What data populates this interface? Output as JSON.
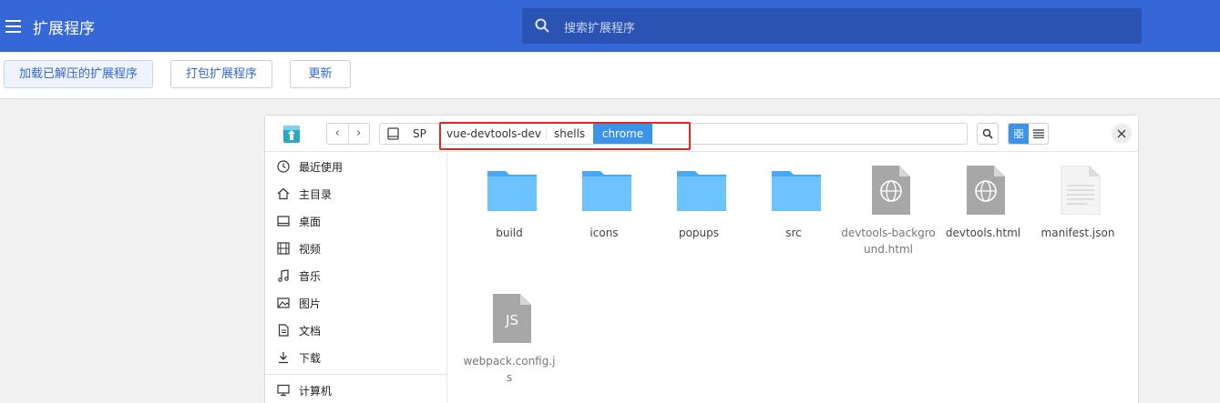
{
  "appbar": {
    "title": "扩展程序",
    "search_placeholder": "搜索扩展程序",
    "color": "#3567d7"
  },
  "toolbar": {
    "load_unpacked": "加载已解压的扩展程序",
    "pack": "打包扩展程序",
    "update": "更新"
  },
  "dialog": {
    "breadcrumbs": [
      "SP",
      "vue-devtools-dev",
      "shells",
      "chrome"
    ],
    "active_crumb": "chrome",
    "sidebar": [
      {
        "label": "最近使用",
        "icon": "clock-icon"
      },
      {
        "label": "主目录",
        "icon": "home-icon"
      },
      {
        "label": "桌面",
        "icon": "desktop-icon"
      },
      {
        "label": "视频",
        "icon": "video-icon"
      },
      {
        "label": "音乐",
        "icon": "music-icon"
      },
      {
        "label": "图片",
        "icon": "picture-icon"
      },
      {
        "label": "文档",
        "icon": "document-icon"
      },
      {
        "label": "下载",
        "icon": "download-icon"
      },
      {
        "label": "计算机",
        "icon": "computer-icon"
      }
    ],
    "files": [
      {
        "name": "build",
        "type": "folder"
      },
      {
        "name": "icons",
        "type": "folder"
      },
      {
        "name": "popups",
        "type": "folder"
      },
      {
        "name": "src",
        "type": "folder"
      },
      {
        "name": "devtools-background.html",
        "type": "html"
      },
      {
        "name": "devtools.html",
        "type": "html"
      },
      {
        "name": "manifest.json",
        "type": "text"
      },
      {
        "name": "webpack.config.js",
        "type": "js"
      }
    ],
    "js_badge": "JS"
  }
}
